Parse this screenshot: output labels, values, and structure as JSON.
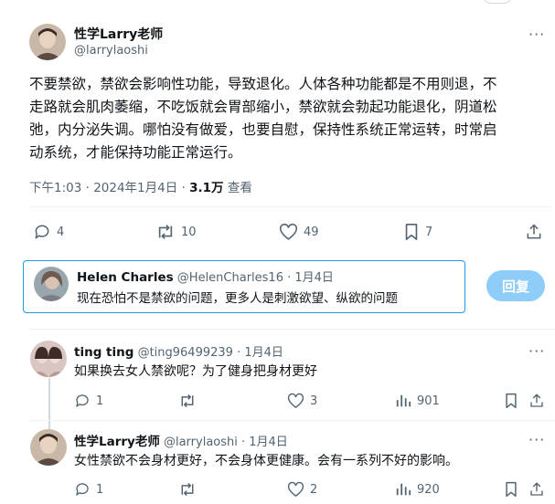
{
  "main_tweet": {
    "author_name": "性学Larry老师",
    "author_handle": "@larrylaoshi",
    "lines": [
      "不要禁欲，禁欲会影响性功能，导致退化。人体各种功能都是不用则退，不",
      "走路就会肌肉萎缩，不吃饭就会胃部缩小，禁欲就会勃起功能退化，阴道松",
      "弛，内分泌失调。哪怕没有做爱，也要自慰，保持性系统正常运转，时常启",
      "动系统，才能保持功能正常运行。"
    ],
    "time": "下午1:03 · 2024年1月4日 · ",
    "views_count": "3.1万",
    "views_label": " 查看",
    "reply_count": "4",
    "retweet_count": "10",
    "like_count": "49",
    "bookmark_count": "7"
  },
  "compose_reply": {
    "quoted_name": "Helen Charles",
    "quoted_handle": "@HelenCharles16 · 1月4日",
    "text": "现在恐怕不是禁欲的问题，更多人是刺激欲望、纵欲的问题",
    "button_label": "回复"
  },
  "replies": [
    {
      "author_name": "ting ting",
      "author_handle": "@ting96499239 · 1月4日",
      "text": "如果换去女人禁欲呢？为了健身把身材更好",
      "reply_count": "1",
      "retweet_count": "",
      "like_count": "3",
      "views_count": "901"
    },
    {
      "author_name": "性学Larry老师",
      "author_handle": "@larrylaoshi · 1月4日",
      "text": "女性禁欲不会身材更好，不会身体更健康。会有一系列不好的影响。",
      "reply_count": "1",
      "retweet_count": "",
      "like_count": "2",
      "views_count": "920"
    }
  ],
  "colors": {
    "accent": "#1d9bf0",
    "muted": "#536471",
    "text": "#0f1419"
  }
}
